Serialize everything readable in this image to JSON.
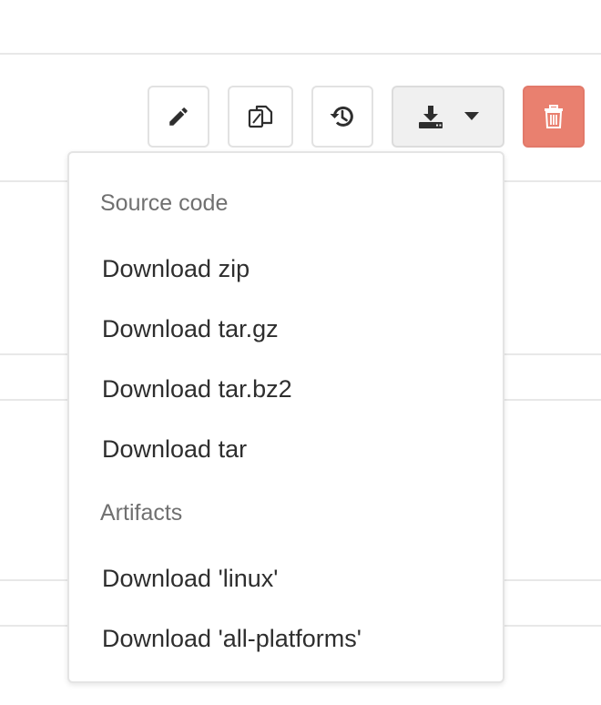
{
  "toolbar": {
    "edit_icon": "pencil-icon",
    "copy_icon": "copy-files-icon",
    "revert_icon": "history-revert-icon",
    "download_icon": "download-icon",
    "caret_icon": "caret-down-icon",
    "delete_icon": "trash-icon",
    "delete_color": "#e9806f"
  },
  "dropdown": {
    "sections": [
      {
        "header": "Source code",
        "items": [
          "Download zip",
          "Download tar.gz",
          "Download tar.bz2",
          "Download tar"
        ]
      },
      {
        "header": "Artifacts",
        "items": [
          "Download 'linux'",
          "Download 'all-platforms'"
        ]
      }
    ]
  }
}
